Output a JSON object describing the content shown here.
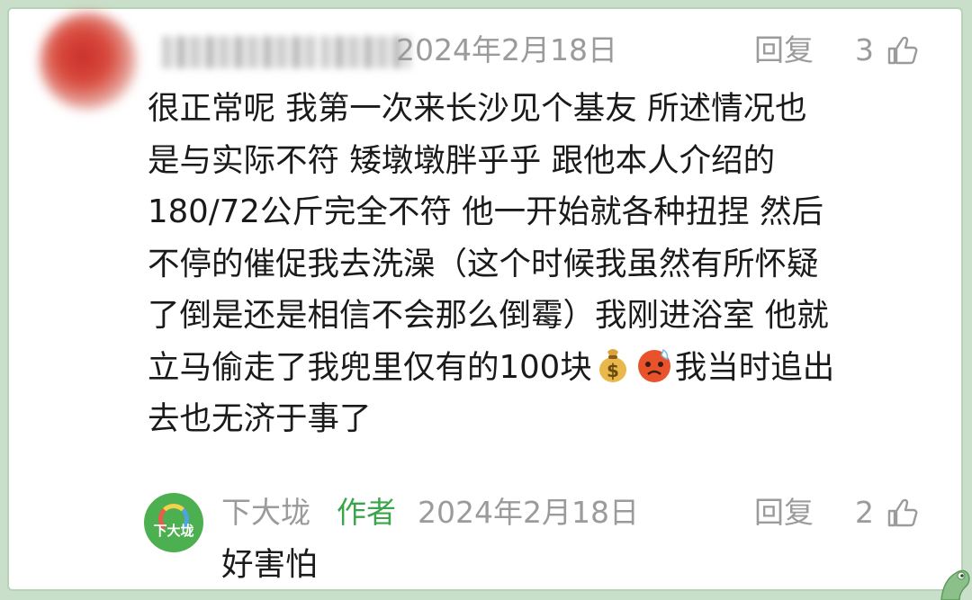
{
  "comment": {
    "date": "2024年2月18日",
    "reply_label": "回复",
    "like_count": "3",
    "lines": [
      "很正常呢 我第一次来长沙见个基友 所述情况也",
      "是与实际不符 矮墩墩胖乎乎 跟他本人介绍的",
      "180/72公斤完全不符 他一开始就各种扭捏 然后",
      "不停的催促我去洗澡（这个时候我虽然有所怀疑",
      "了倒是还是相信不会那么倒霉）我刚进浴室 他就"
    ],
    "line6_before": "立马偷走了我兜里仅有的100块",
    "line6_after": "我当时追出",
    "line7": "去也无济于事了",
    "emojis": [
      "money-bag-emoji",
      "angry-face-emoji"
    ]
  },
  "reply": {
    "avatar_text": "下大垅",
    "author": "下大垅",
    "author_tag": "作者",
    "date": "2024年2月18日",
    "reply_label": "回复",
    "like_count": "2",
    "text": "好害怕"
  },
  "colors": {
    "meta_gray": "#9b9b9b",
    "author_green": "#3aa54a",
    "text": "#1a1a1a",
    "frame_green": "#b7d3b6"
  }
}
